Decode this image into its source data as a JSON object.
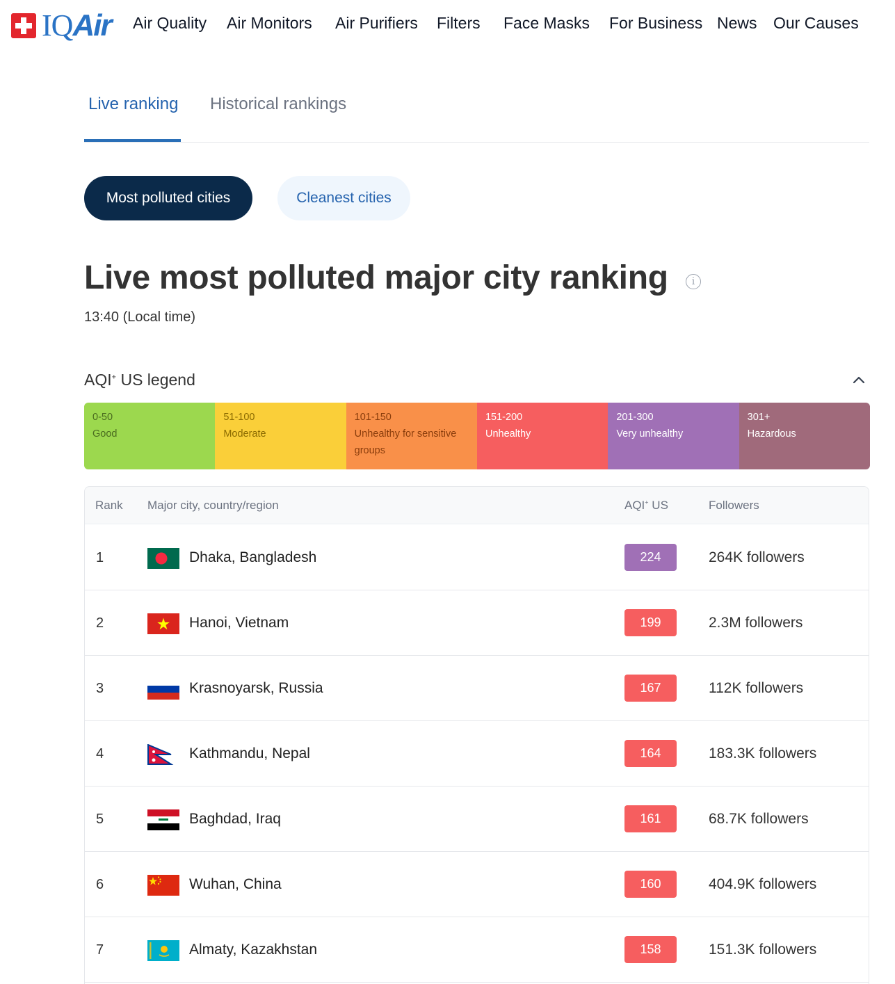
{
  "brand": {
    "name_iq": "IQ",
    "name_air": "Air"
  },
  "nav": [
    "Air Quality",
    "Air Monitors",
    "Air Purifiers",
    "Filters",
    "Face Masks",
    "For Business",
    "News",
    "Our Causes"
  ],
  "tabs": {
    "live": "Live ranking",
    "historical": "Historical rankings"
  },
  "pills": {
    "polluted": "Most polluted cities",
    "cleanest": "Cleanest cities"
  },
  "title": "Live most polluted major city ranking",
  "local_time": "13:40 (Local time)",
  "legend": {
    "title_pre": "AQI",
    "title_sup": "+",
    "title_post": " US legend",
    "segments": [
      {
        "range": "0-50",
        "label": "Good",
        "bg": "#9cd84e",
        "fg": "#4a6b1f"
      },
      {
        "range": "51-100",
        "label": "Moderate",
        "bg": "#facf39",
        "fg": "#8a6a00"
      },
      {
        "range": "101-150",
        "label": "Unhealthy for sensitive groups",
        "bg": "#f99049",
        "fg": "#8a3d0c"
      },
      {
        "range": "151-200",
        "label": "Unhealthy",
        "bg": "#f65e5f",
        "fg": "#ffffff"
      },
      {
        "range": "201-300",
        "label": "Very unhealthy",
        "bg": "#a070b6",
        "fg": "#ffffff"
      },
      {
        "range": "301+",
        "label": "Hazardous",
        "bg": "#a06a7b",
        "fg": "#ffffff"
      }
    ]
  },
  "table": {
    "headers": {
      "rank": "Rank",
      "city": "Major city, country/region",
      "aqi_pre": "AQI",
      "aqi_sup": "+",
      "aqi_post": " US",
      "followers": "Followers"
    },
    "rows": [
      {
        "rank": "1",
        "city": "Dhaka, Bangladesh",
        "aqi": "224",
        "aqi_color": "#a070b6",
        "followers": "264K followers",
        "flag": "bangladesh-flag"
      },
      {
        "rank": "2",
        "city": "Hanoi, Vietnam",
        "aqi": "199",
        "aqi_color": "#f65e5f",
        "followers": "2.3M followers",
        "flag": "vietnam-flag"
      },
      {
        "rank": "3",
        "city": "Krasnoyarsk, Russia",
        "aqi": "167",
        "aqi_color": "#f65e5f",
        "followers": "112K followers",
        "flag": "russia-flag"
      },
      {
        "rank": "4",
        "city": "Kathmandu, Nepal",
        "aqi": "164",
        "aqi_color": "#f65e5f",
        "followers": "183.3K followers",
        "flag": "nepal-flag"
      },
      {
        "rank": "5",
        "city": "Baghdad, Iraq",
        "aqi": "161",
        "aqi_color": "#f65e5f",
        "followers": "68.7K followers",
        "flag": "iraq-flag"
      },
      {
        "rank": "6",
        "city": "Wuhan, China",
        "aqi": "160",
        "aqi_color": "#f65e5f",
        "followers": "404.9K followers",
        "flag": "china-flag"
      },
      {
        "rank": "7",
        "city": "Almaty, Kazakhstan",
        "aqi": "158",
        "aqi_color": "#f65e5f",
        "followers": "151.3K followers",
        "flag": "kazakhstan-flag"
      }
    ]
  }
}
